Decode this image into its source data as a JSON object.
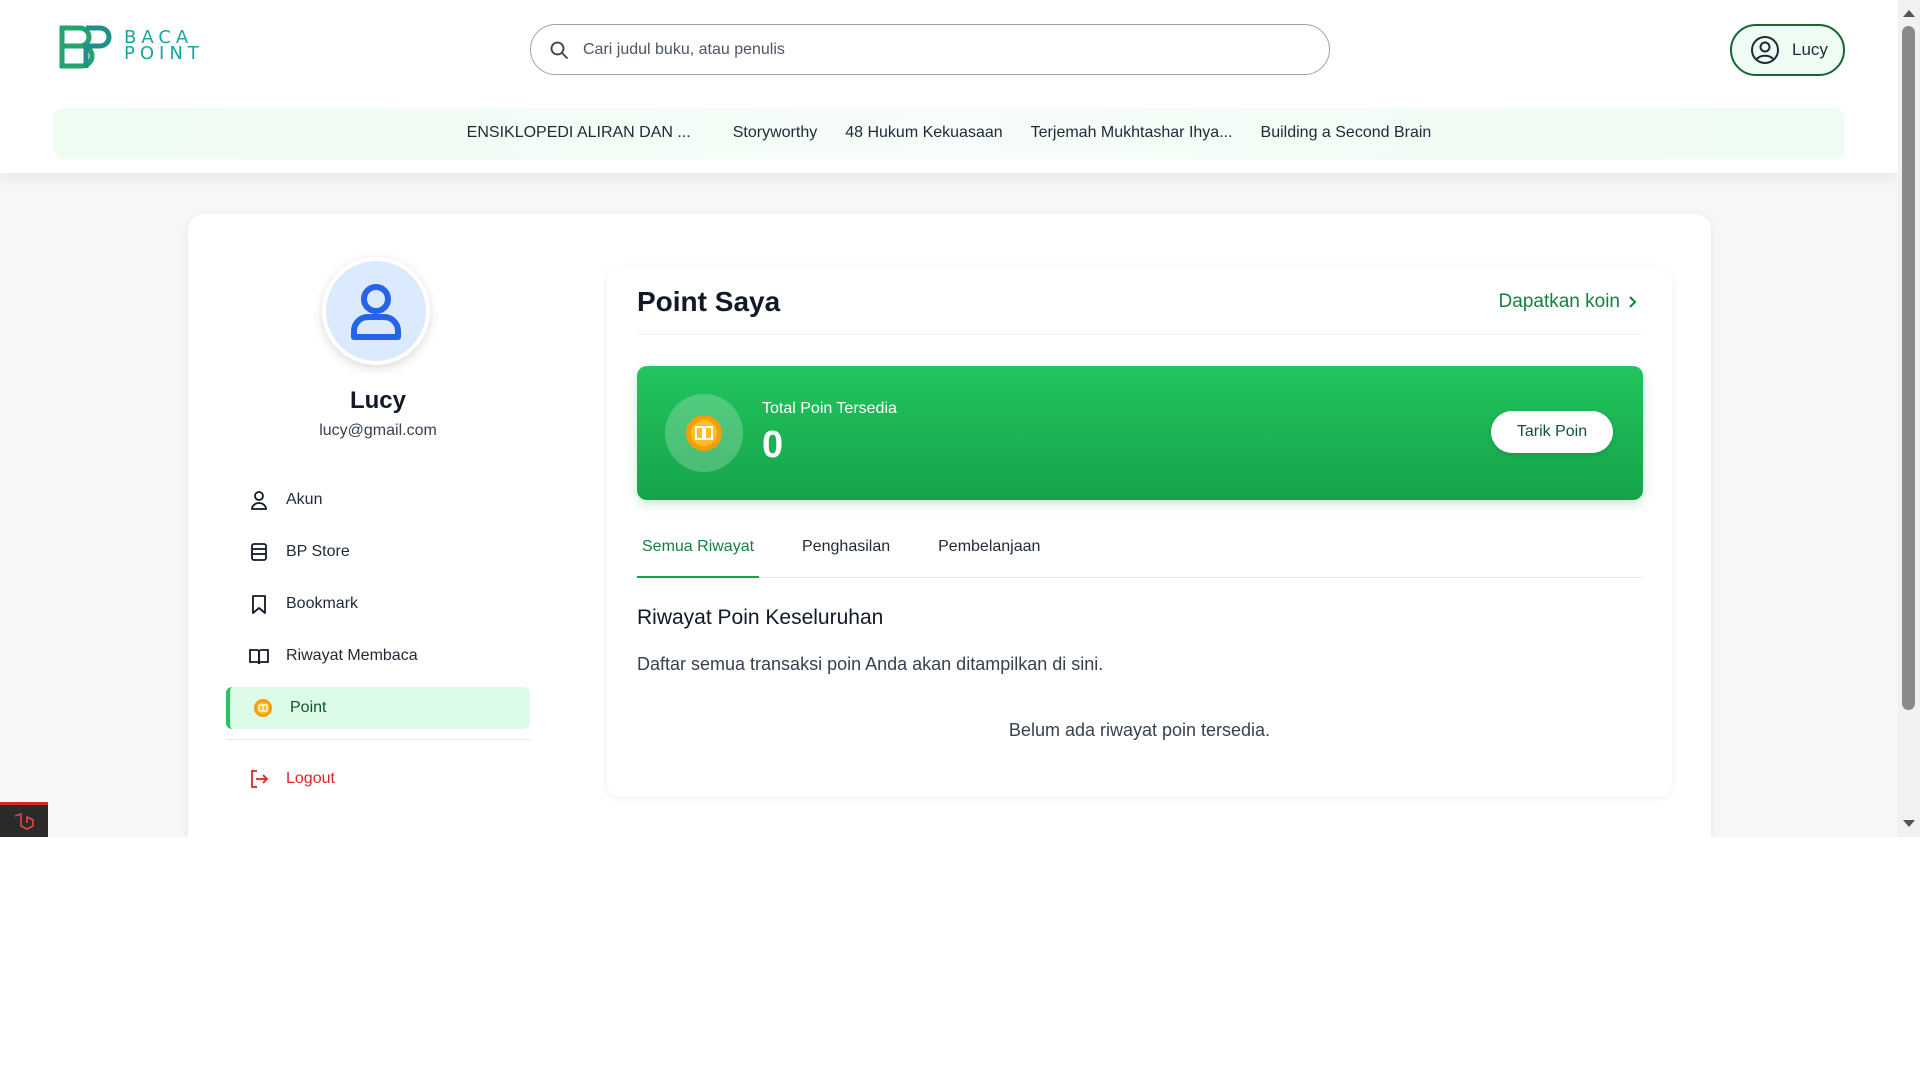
{
  "header": {
    "logo_line1": "BACA",
    "logo_line2": "POINT",
    "search_placeholder": "Cari judul buku, atau penulis",
    "user_label": "Lucy"
  },
  "book_nav": [
    "ENSIKLOPEDI ALIRAN DAN ...",
    "Storyworthy",
    "48 Hukum Kekuasaan",
    "Terjemah Mukhtashar Ihya...",
    "Building a Second Brain"
  ],
  "profile": {
    "name": "Lucy",
    "email": "lucy@gmail.com"
  },
  "menu": {
    "akun": "Akun",
    "store": "BP Store",
    "bookmark": "Bookmark",
    "history": "Riwayat Membaca",
    "point": "Point",
    "logout": "Logout"
  },
  "panel": {
    "title": "Point Saya",
    "get_coin": "Dapatkan koin",
    "points_label": "Total Poin Tersedia",
    "points_value": "0",
    "withdraw": "Tarik Poin",
    "tabs": [
      "Semua Riwayat",
      "Penghasilan",
      "Pembelanjaan"
    ],
    "history_title": "Riwayat Poin Keseluruhan",
    "history_desc": "Daftar semua transaksi poin Anda akan ditampilkan di sini.",
    "history_empty": "Belum ada riwayat poin tersedia."
  },
  "colors": {
    "brand_green": "#16a34a",
    "logout_red": "#dc2626"
  }
}
